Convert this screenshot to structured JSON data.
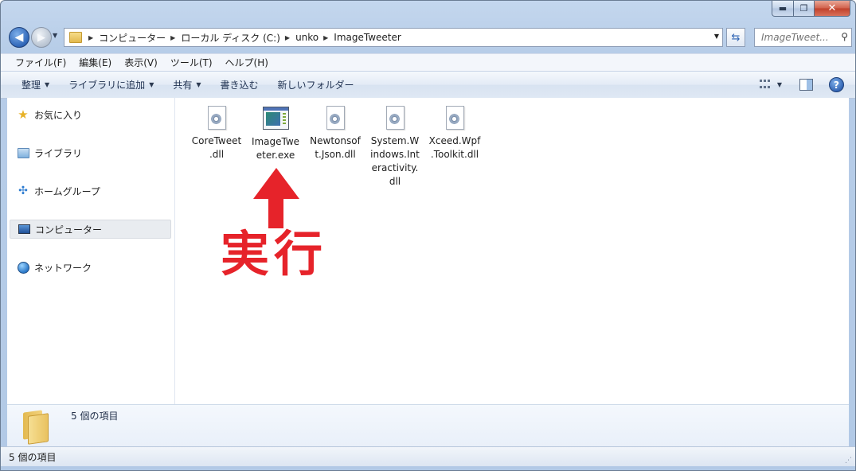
{
  "window": {
    "caption": {
      "minimize": "▬",
      "maximize": "❐",
      "close": "✕"
    }
  },
  "address": {
    "crumbs": [
      "コンピューター",
      "ローカル ディスク (C:)",
      "unko",
      "ImageTweeter"
    ],
    "search_placeholder": "ImageTweet..."
  },
  "menubar": {
    "items": [
      "ファイル(F)",
      "編集(E)",
      "表示(V)",
      "ツール(T)",
      "ヘルプ(H)"
    ]
  },
  "cmdbar": {
    "organize": "整理",
    "add_to_library": "ライブラリに追加",
    "share": "共有",
    "burn": "書き込む",
    "new_folder": "新しいフォルダー",
    "help": "?"
  },
  "nav_pane": {
    "favorites": "お気に入り",
    "libraries": "ライブラリ",
    "homegroup": "ホームグループ",
    "computer": "コンピューター",
    "network": "ネットワーク"
  },
  "files": [
    {
      "line1": "CoreTweet",
      "line2": ".dll",
      "line3": "",
      "line4": "",
      "icon": "dll-file-icon"
    },
    {
      "line1": "ImageTwe",
      "line2": "eter.exe",
      "line3": "",
      "line4": "",
      "icon": "exe-file-icon"
    },
    {
      "line1": "Newtonsof",
      "line2": "t.Json.dll",
      "line3": "",
      "line4": "",
      "icon": "dll-file-icon"
    },
    {
      "line1": "System.W",
      "line2": "indows.Int",
      "line3": "eractivity.",
      "line4": "dll",
      "icon": "dll-file-icon"
    },
    {
      "line1": "Xceed.Wpf",
      "line2": ".Toolkit.dll",
      "line3": "",
      "line4": "",
      "icon": "dll-file-icon"
    }
  ],
  "annotation": {
    "text": "実行",
    "color": "#e6232a"
  },
  "details": {
    "count": "5 個の項目"
  },
  "status": {
    "count": "5 個の項目"
  }
}
